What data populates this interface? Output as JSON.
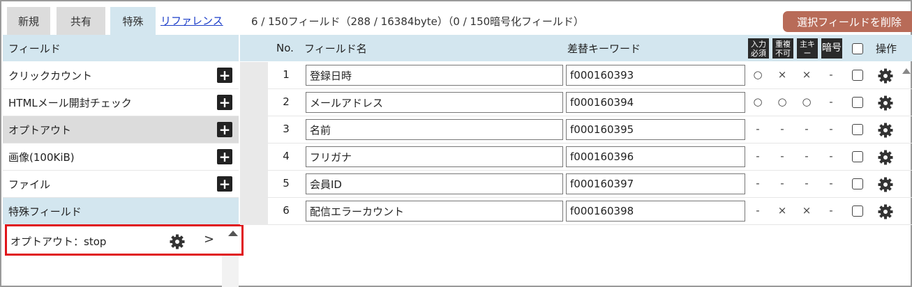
{
  "tabs": [
    {
      "label": "新規",
      "active": false
    },
    {
      "label": "共有",
      "active": false
    },
    {
      "label": "特殊",
      "active": true
    }
  ],
  "reference_link": "リファレンス",
  "field_count_text": "6 / 150フィールド（288 / 16384byte）（0 / 150暗号化フィールド）",
  "delete_button": "選択フィールドを削除",
  "left_panel": {
    "header": "フィールド",
    "items": [
      {
        "label": "クリックカウント",
        "highlighted": false
      },
      {
        "label": "HTMLメール開封チェック",
        "highlighted": false
      },
      {
        "label": "オプトアウト",
        "highlighted": true
      },
      {
        "label": "画像(100KiB)",
        "highlighted": false
      },
      {
        "label": "ファイル",
        "highlighted": false
      }
    ],
    "special_header": "特殊フィールド",
    "special_item": {
      "label": "オプトアウト：stop",
      "arrow": ">"
    }
  },
  "table": {
    "headers": {
      "no": "No.",
      "name": "フィールド名",
      "keyword": "差替キーワード",
      "badge_input": "入力必須",
      "badge_unique": "重複不可",
      "badge_key": "主キー",
      "badge_encrypt": "暗号",
      "ops": "操作"
    },
    "rows": [
      {
        "no": "1",
        "name": "登録日時",
        "keyword": "f000160393",
        "required": "○",
        "unique": "×",
        "key": "×",
        "encrypt": "-"
      },
      {
        "no": "2",
        "name": "メールアドレス",
        "keyword": "f000160394",
        "required": "○",
        "unique": "○",
        "key": "○",
        "encrypt": "-"
      },
      {
        "no": "3",
        "name": "名前",
        "keyword": "f000160395",
        "required": "-",
        "unique": "-",
        "key": "-",
        "encrypt": "-"
      },
      {
        "no": "4",
        "name": "フリガナ",
        "keyword": "f000160396",
        "required": "-",
        "unique": "-",
        "key": "-",
        "encrypt": "-"
      },
      {
        "no": "5",
        "name": "会員ID",
        "keyword": "f000160397",
        "required": "-",
        "unique": "-",
        "key": "-",
        "encrypt": "-"
      },
      {
        "no": "6",
        "name": "配信エラーカウント",
        "keyword": "f000160398",
        "required": "-",
        "unique": "×",
        "key": "×",
        "encrypt": "-"
      }
    ]
  },
  "colors": {
    "header_bg": "#d3e6ef",
    "tab_bg": "#dcdcdc",
    "delete_button_bg": "#b86b58",
    "highlight_border": "#e0151a",
    "link": "#1a3cc8"
  }
}
